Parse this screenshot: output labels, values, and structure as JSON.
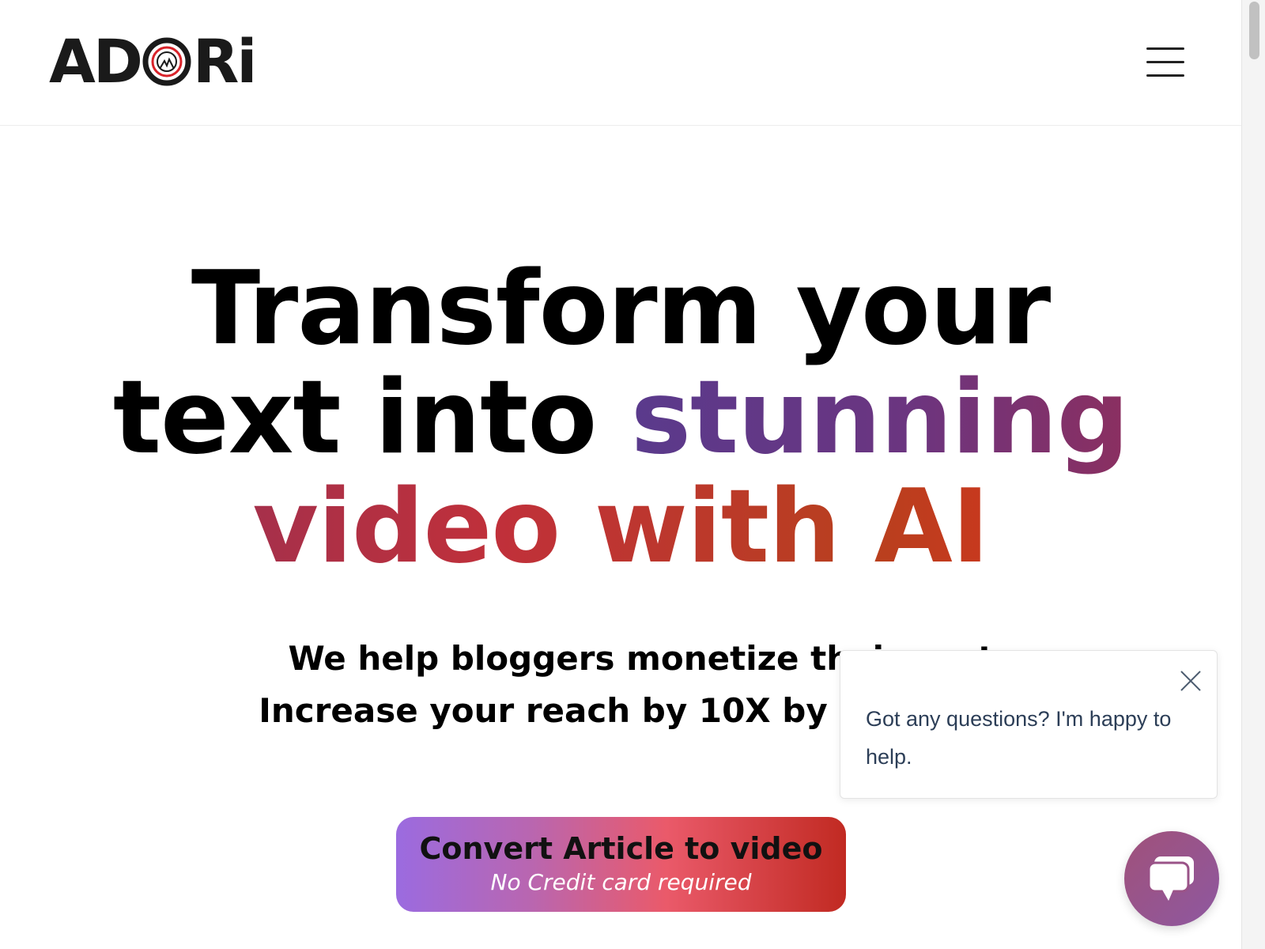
{
  "header": {
    "logo_text_left": "AD",
    "logo_text_right": "Ri",
    "menu_icon": "hamburger-menu-icon"
  },
  "hero": {
    "line1": "Transform your",
    "line2_plain": "text into ",
    "line2_accent": "stunning",
    "line3": "video with AI",
    "subtitle_line1": "We help bloggers monetize their conte",
    "subtitle_line2": "Increase your reach by 10X by Convertir"
  },
  "cta": {
    "main_label": "Convert Article to video",
    "sub_label": "No Credit card required"
  },
  "chat": {
    "message": "Got any questions? I'm happy to help.",
    "close_icon": "close-icon",
    "launcher_icon": "chat-bubble-icon"
  },
  "colors": {
    "accent_purple": "#5a3a8c",
    "accent_red": "#e8281e",
    "chat_launcher": "#9a5388"
  }
}
